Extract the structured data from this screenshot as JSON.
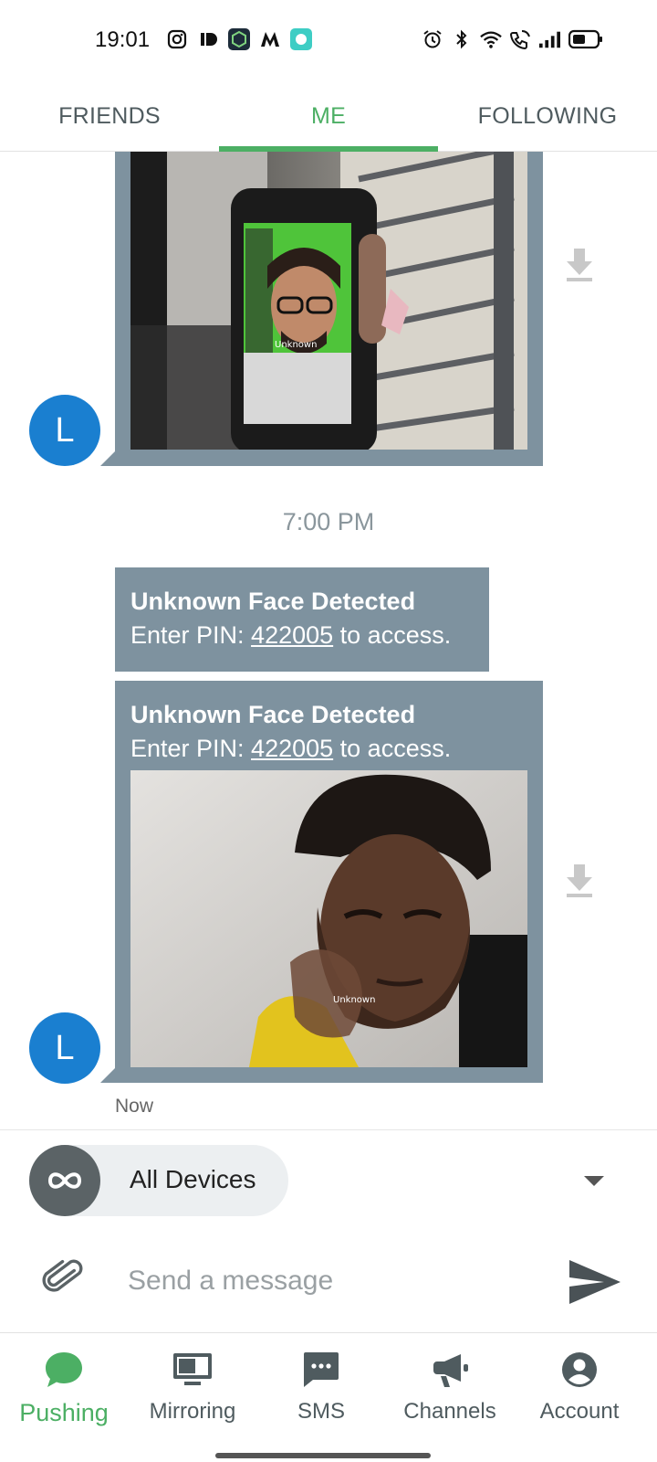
{
  "status_bar": {
    "time": "19:01",
    "left_icons": [
      "instagram-icon",
      "id-app-icon",
      "vpn-app-icon",
      "myntra-icon",
      "chat-app-icon"
    ],
    "right_icons": [
      "alarm-icon",
      "bluetooth-icon",
      "wifi-icon",
      "wifi-calling-icon",
      "signal-icon",
      "battery-icon"
    ]
  },
  "top_tabs": [
    {
      "label": "FRIENDS",
      "active": false
    },
    {
      "label": "ME",
      "active": true
    },
    {
      "label": "FOLLOWING",
      "active": false
    }
  ],
  "messages": [
    {
      "type": "image",
      "avatar_letter": "L",
      "photo_overlay_text": "Unknown"
    },
    {
      "type": "timestamp",
      "text": "7:00 PM"
    },
    {
      "type": "text",
      "title": "Unknown Face Detected",
      "body_prefix": "Enter PIN: ",
      "pin": "422005",
      "body_suffix": " to access."
    },
    {
      "type": "text_image",
      "avatar_letter": "L",
      "title": "Unknown Face Detected",
      "body_prefix": "Enter PIN: ",
      "pin": "422005",
      "body_suffix": " to access.",
      "photo_overlay_text": "Unknown",
      "time": "Now"
    }
  ],
  "composer": {
    "device_label": "All Devices",
    "placeholder": "Send a message"
  },
  "bottom_nav": [
    {
      "label": "Pushing",
      "icon": "chat-bubble-icon",
      "active": true
    },
    {
      "label": "Mirroring",
      "icon": "monitor-icon",
      "active": false
    },
    {
      "label": "SMS",
      "icon": "sms-icon",
      "active": false
    },
    {
      "label": "Channels",
      "icon": "megaphone-icon",
      "active": false
    },
    {
      "label": "Account",
      "icon": "account-icon",
      "active": false
    }
  ],
  "colors": {
    "accent": "#4caf64",
    "bubble": "#7e929f",
    "avatar": "#1a7fd0"
  }
}
